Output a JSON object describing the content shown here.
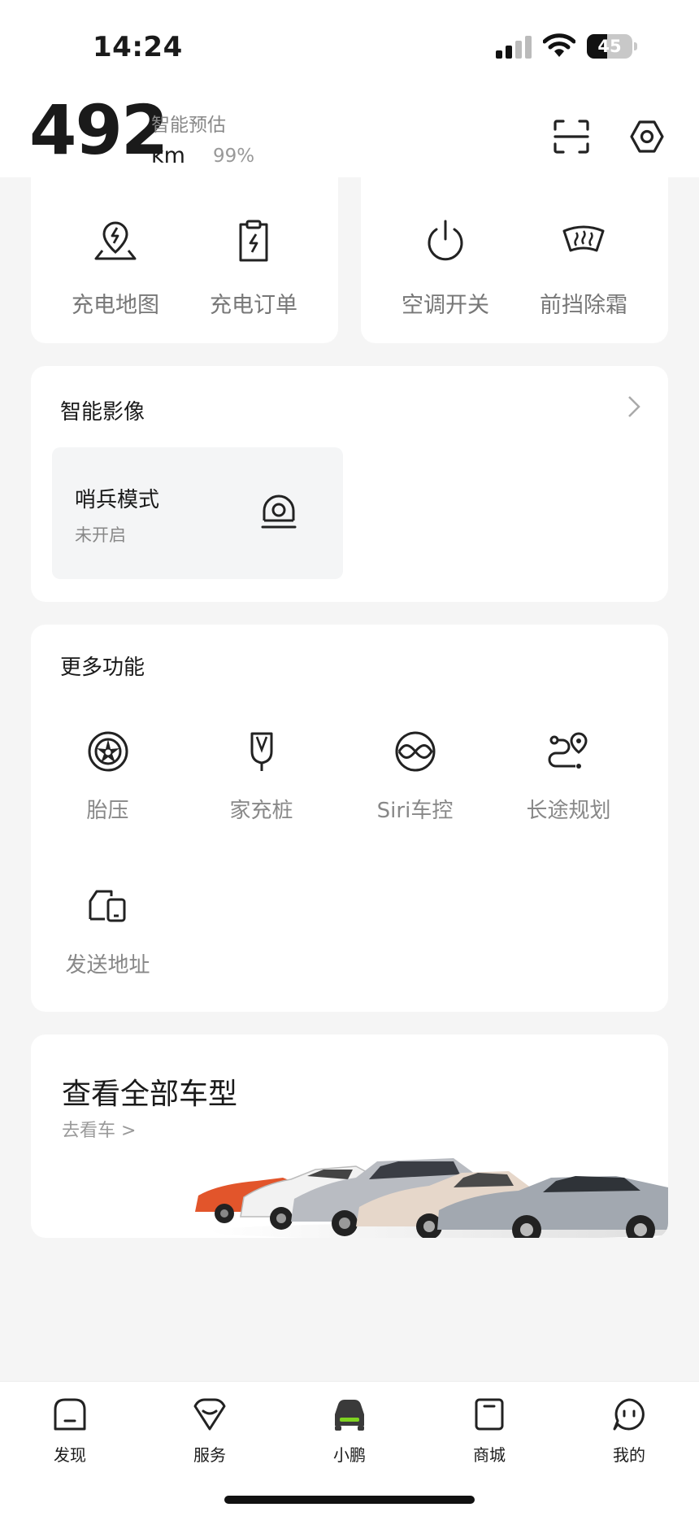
{
  "status_bar": {
    "time": "14:24",
    "battery_level": "45",
    "battery_fraction": 0.45
  },
  "header": {
    "range_value": "492",
    "range_label": "智能预估",
    "range_unit": "km",
    "battery_percent": "99%"
  },
  "quick_actions": [
    {
      "label": "充电地图",
      "icon": "charging-map-icon"
    },
    {
      "label": "充电订单",
      "icon": "charging-order-icon"
    },
    {
      "label": "空调开关",
      "icon": "power-icon"
    },
    {
      "label": "前挡除霜",
      "icon": "defrost-icon"
    }
  ],
  "smart_imaging": {
    "title": "智能影像",
    "sentry_title": "哨兵模式",
    "sentry_status": "未开启"
  },
  "more_features": {
    "title": "更多功能",
    "items": [
      {
        "label": "胎压",
        "icon": "tire-pressure-icon"
      },
      {
        "label": "家充桩",
        "icon": "home-charger-icon"
      },
      {
        "label": "Siri车控",
        "icon": "siri-icon"
      },
      {
        "label": "长途规划",
        "icon": "route-planning-icon"
      },
      {
        "label": "发送地址",
        "icon": "send-address-icon"
      }
    ]
  },
  "models": {
    "title": "查看全部车型",
    "link": "去看车 >"
  },
  "tabbar": {
    "active_color": "#7ed321",
    "items": [
      {
        "label": "发现",
        "icon": "discover-icon"
      },
      {
        "label": "服务",
        "icon": "service-icon"
      },
      {
        "label": "小鹏",
        "icon": "car-icon",
        "active": true
      },
      {
        "label": "商城",
        "icon": "shop-icon"
      },
      {
        "label": "我的",
        "icon": "profile-icon"
      }
    ]
  }
}
